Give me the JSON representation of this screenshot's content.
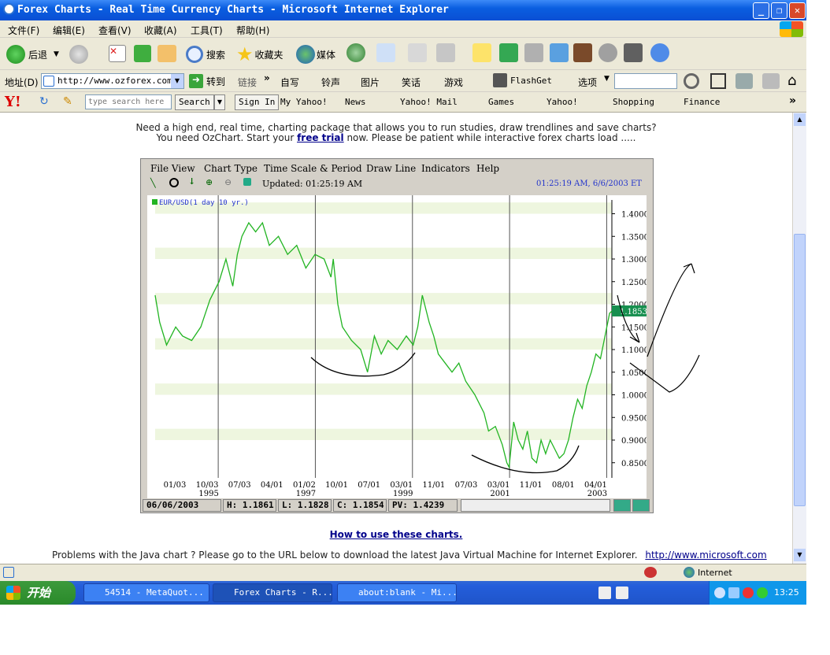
{
  "window": {
    "title": "Forex Charts - Real Time Currency Charts - Microsoft Internet Explorer"
  },
  "menu": [
    "文件(F)",
    "编辑(E)",
    "查看(V)",
    "收藏(A)",
    "工具(T)",
    "帮助(H)"
  ],
  "toolbar": {
    "back": "后退",
    "search": "搜索",
    "favorites": "收藏夹",
    "media": "媒体"
  },
  "address": {
    "label": "地址(D)",
    "url": "http://www.ozforex.com.",
    "go": "转到",
    "links": "链接",
    "linkItems": [
      "自写",
      "铃声",
      "图片",
      "笑话",
      "游戏"
    ],
    "flashget": "FlashGet",
    "options": "选项"
  },
  "yahoo": {
    "search_placeholder": "type search here",
    "search_btn": "Search",
    "signin": "Sign In",
    "items": [
      "My Yahoo!",
      "News",
      "Yahoo! Mail",
      "Games",
      "Yahoo!",
      "Shopping",
      "Finance"
    ]
  },
  "page": {
    "promo1": "Need a high end, real time, charting package that allows you to run studies, draw trendlines and save charts?",
    "promo2a": "You need OzChart. Start your ",
    "promo2link": "free trial",
    "promo2b": " now.  Please be patient while interactive forex charts load .....",
    "howto": "How to use these charts.",
    "java_text": "Problems with the Java chart ?  Please go to the URL below to download the latest Java Virtual Machine for Internet Explorer.",
    "java_link": "http://www.microsoft.com"
  },
  "applet": {
    "menu": [
      "File View",
      "Chart Type",
      "Time Scale & Period",
      "Draw Line",
      "Indicators",
      "Help"
    ],
    "updated": "Updated: 01:25:19 AM",
    "timestamp": "01:25:19 AM, 6/6/2003 ET",
    "legend": "EUR/USD(1 day  10 yr.)",
    "last_price": "1.1853",
    "status": {
      "date": "06/06/2003",
      "high": "H: 1.1861",
      "low": "L: 1.1828",
      "close": "C: 1.1854",
      "pv": "PV: 1.4239"
    }
  },
  "chart_data": {
    "type": "line",
    "title": "EUR/USD(1 day  10 yr.)",
    "ylim": [
      0.82,
      1.42
    ],
    "yticks": [
      "1.4000",
      "1.3500",
      "1.3000",
      "1.2500",
      "1.2000",
      "1.1500",
      "1.1000",
      "1.0500",
      "1.0000",
      "0.9500",
      "0.9000",
      "0.8500"
    ],
    "xticks": [
      {
        "label": "01/03",
        "year": ""
      },
      {
        "label": "10/03",
        "year": "1995"
      },
      {
        "label": "07/03",
        "year": ""
      },
      {
        "label": "04/01",
        "year": ""
      },
      {
        "label": "01/02",
        "year": "1997"
      },
      {
        "label": "10/01",
        "year": ""
      },
      {
        "label": "07/01",
        "year": ""
      },
      {
        "label": "03/01",
        "year": "1999"
      },
      {
        "label": "11/01",
        "year": ""
      },
      {
        "label": "07/03",
        "year": ""
      },
      {
        "label": "03/01",
        "year": "2001"
      },
      {
        "label": "11/01",
        "year": ""
      },
      {
        "label": "08/01",
        "year": ""
      },
      {
        "label": "04/01",
        "year": "2003"
      }
    ],
    "series": [
      {
        "name": "EUR/USD",
        "color": "#22b422",
        "points": [
          [
            0,
            1.22
          ],
          [
            0.01,
            1.16
          ],
          [
            0.025,
            1.11
          ],
          [
            0.045,
            1.15
          ],
          [
            0.06,
            1.13
          ],
          [
            0.08,
            1.12
          ],
          [
            0.1,
            1.15
          ],
          [
            0.12,
            1.21
          ],
          [
            0.14,
            1.25
          ],
          [
            0.155,
            1.3
          ],
          [
            0.17,
            1.24
          ],
          [
            0.18,
            1.31
          ],
          [
            0.19,
            1.35
          ],
          [
            0.205,
            1.38
          ],
          [
            0.22,
            1.36
          ],
          [
            0.235,
            1.38
          ],
          [
            0.25,
            1.33
          ],
          [
            0.27,
            1.35
          ],
          [
            0.29,
            1.31
          ],
          [
            0.31,
            1.33
          ],
          [
            0.33,
            1.28
          ],
          [
            0.35,
            1.31
          ],
          [
            0.37,
            1.3
          ],
          [
            0.385,
            1.26
          ],
          [
            0.39,
            1.3
          ],
          [
            0.4,
            1.2
          ],
          [
            0.41,
            1.15
          ],
          [
            0.43,
            1.12
          ],
          [
            0.45,
            1.1
          ],
          [
            0.465,
            1.05
          ],
          [
            0.48,
            1.13
          ],
          [
            0.495,
            1.09
          ],
          [
            0.51,
            1.12
          ],
          [
            0.53,
            1.1
          ],
          [
            0.55,
            1.13
          ],
          [
            0.565,
            1.11
          ],
          [
            0.575,
            1.15
          ],
          [
            0.585,
            1.22
          ],
          [
            0.595,
            1.18
          ],
          [
            0.6,
            1.16
          ],
          [
            0.61,
            1.13
          ],
          [
            0.62,
            1.09
          ],
          [
            0.635,
            1.07
          ],
          [
            0.65,
            1.05
          ],
          [
            0.665,
            1.07
          ],
          [
            0.68,
            1.03
          ],
          [
            0.7,
            1.0
          ],
          [
            0.72,
            0.96
          ],
          [
            0.73,
            0.92
          ],
          [
            0.745,
            0.93
          ],
          [
            0.76,
            0.89
          ],
          [
            0.77,
            0.85
          ],
          [
            0.775,
            0.84
          ],
          [
            0.78,
            0.89
          ],
          [
            0.785,
            0.94
          ],
          [
            0.795,
            0.9
          ],
          [
            0.805,
            0.88
          ],
          [
            0.815,
            0.92
          ],
          [
            0.825,
            0.86
          ],
          [
            0.835,
            0.85
          ],
          [
            0.845,
            0.9
          ],
          [
            0.855,
            0.87
          ],
          [
            0.865,
            0.9
          ],
          [
            0.875,
            0.88
          ],
          [
            0.885,
            0.86
          ],
          [
            0.895,
            0.87
          ],
          [
            0.905,
            0.9
          ],
          [
            0.915,
            0.95
          ],
          [
            0.925,
            0.99
          ],
          [
            0.935,
            0.97
          ],
          [
            0.945,
            1.02
          ],
          [
            0.955,
            1.05
          ],
          [
            0.965,
            1.09
          ],
          [
            0.975,
            1.08
          ],
          [
            0.985,
            1.13
          ],
          [
            0.995,
            1.18
          ],
          [
            1.0,
            1.185
          ]
        ]
      }
    ]
  },
  "statusbar": {
    "zone": "Internet"
  },
  "taskbar": {
    "start": "开始",
    "tasks": [
      "54514 - MetaQuot...",
      "Forex Charts - R...",
      "about:blank - Mi..."
    ],
    "clock": "13:25"
  },
  "colors": {
    "xp_blue": "#0a5ee0",
    "chart_green": "#22b422",
    "band": "#eef6df",
    "last_price_bg": "#178f4f"
  }
}
